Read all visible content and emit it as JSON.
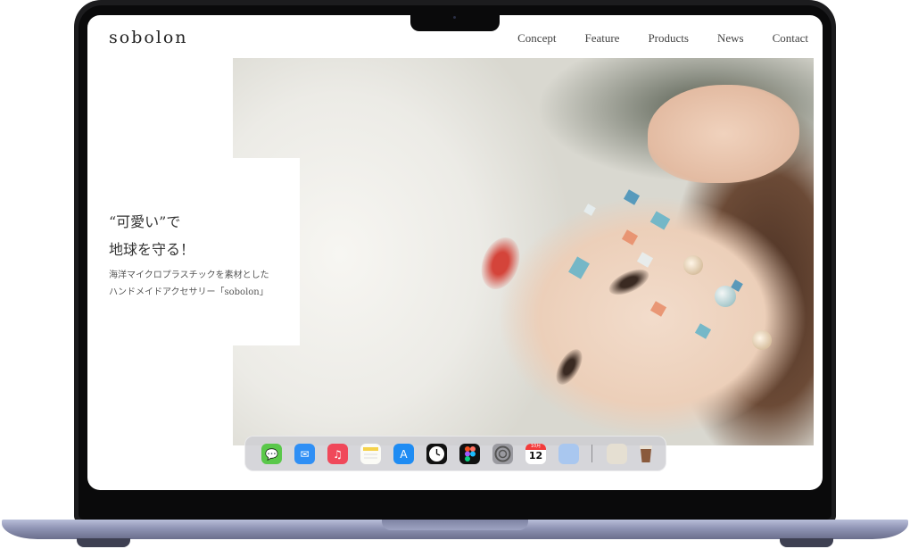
{
  "site": {
    "logo": "sobolon",
    "nav": [
      "Concept",
      "Feature",
      "Products",
      "News",
      "Contact"
    ]
  },
  "hero": {
    "headline_line1": "“可愛い”で",
    "headline_line2": "地球を守る！",
    "subtext_line1": "海洋マイクロプラスチックを素材とした",
    "subtext_line2": "ハンドメイドアクセサリー「sobolon」"
  },
  "dock": {
    "apps": [
      "messages-icon",
      "mail-icon",
      "music-icon",
      "notes-icon",
      "app-store-icon",
      "clock-icon",
      "figma-icon",
      "system-settings-icon",
      "calendar-icon",
      "preview-icon",
      "document-icon",
      "coffee-cup-icon"
    ],
    "calendar_month": "10月",
    "calendar_day": "12"
  },
  "colors": {
    "laptop_bezel": "#1c1c1e",
    "laptop_base": "#8f94b4",
    "text": "#333333",
    "dock_bg": "#cdcdd2"
  }
}
